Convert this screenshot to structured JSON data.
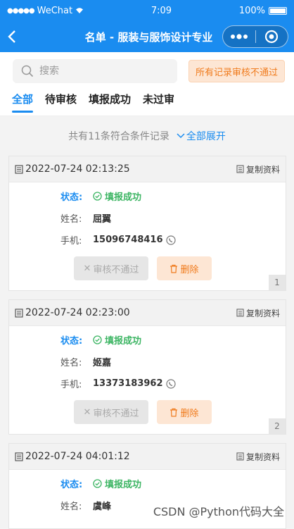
{
  "status_bar": {
    "carrier": "WeChat",
    "time": "7:09",
    "battery": "100%"
  },
  "nav": {
    "title": "名单 - 服装与服饰设计专业"
  },
  "search": {
    "placeholder": "搜索",
    "value": ""
  },
  "reject_all_label": "所有记录审核不通过",
  "tabs": [
    {
      "label": "全部",
      "active": true
    },
    {
      "label": "待审核",
      "active": false
    },
    {
      "label": "填报成功",
      "active": false
    },
    {
      "label": "未过审",
      "active": false
    }
  ],
  "summary": {
    "text": "共有11条符合条件记录",
    "expand_label": "全部展开"
  },
  "card_labels": {
    "copy": "复制资料",
    "status": "状态:",
    "name": "姓名:",
    "phone": "手机:",
    "reject": "审核不通过",
    "delete": "删除"
  },
  "records": [
    {
      "datetime": "2022-07-24 02:13:25",
      "status": "填报成功",
      "name": "屈翼",
      "phone": "15096748416",
      "index": "1"
    },
    {
      "datetime": "2022-07-24 02:23:00",
      "status": "填报成功",
      "name": "姬嘉",
      "phone": "13373183962",
      "index": "2"
    },
    {
      "datetime": "2022-07-24 04:01:12",
      "status": "填报成功",
      "name": "虞峰",
      "phone": "",
      "index": ""
    }
  ],
  "watermark": "CSDN @Python代码大全",
  "colors": {
    "primary": "#1a8cf0",
    "success": "#3cb563",
    "warning": "#f07b1d"
  }
}
